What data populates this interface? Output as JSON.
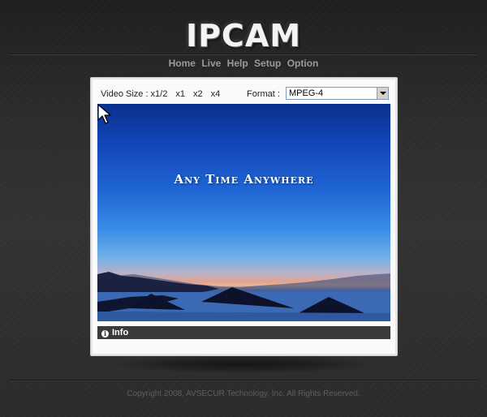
{
  "header": {
    "logo": "IPCAM",
    "nav": [
      "Home",
      "Live",
      "Help",
      "Setup",
      "Option"
    ]
  },
  "viewer": {
    "video_size_label": "Video Size :",
    "sizes": [
      "x1/2",
      "x1",
      "x2",
      "x4"
    ],
    "format_label": "Format :",
    "format_value": "MPEG-4",
    "caption": "Any Time Anywhere",
    "info_label": "Info"
  },
  "footer": {
    "copyright": "Copyright 2008, AVSECUR Technology, Inc. All Rights Reserved."
  },
  "colors": {
    "background": "#2a2a2a",
    "panel": "#fafafa",
    "info_bar": "#3a3a3a",
    "nav_text": "#9a9a9a",
    "footer_text": "#5e5e5e"
  },
  "icons": [
    "info-icon",
    "dropdown-arrow-icon",
    "mouse-pointer-icon"
  ]
}
